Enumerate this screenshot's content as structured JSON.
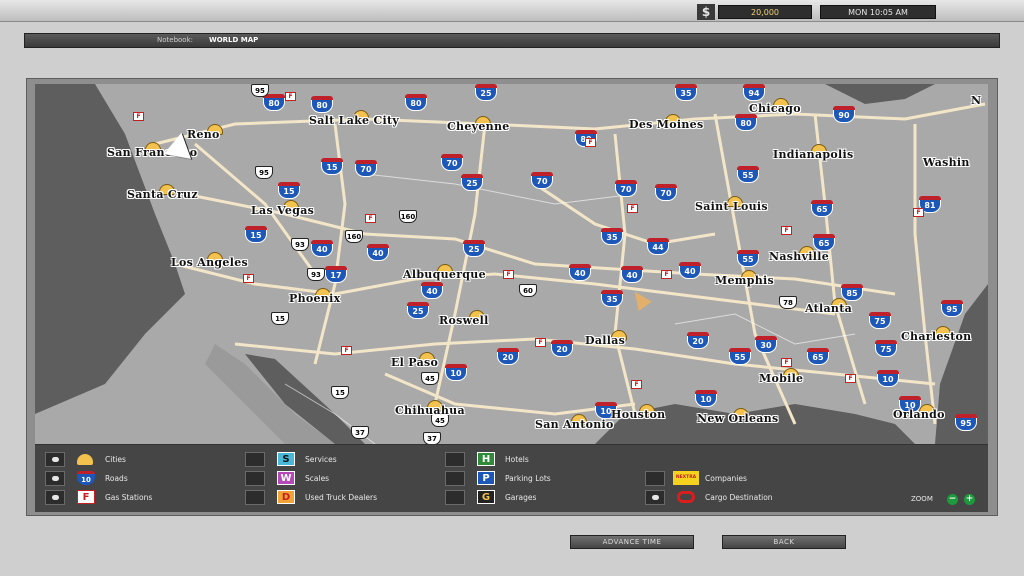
{
  "status": {
    "money_icon": "$",
    "money": "20,000",
    "time": "MON 10:05 AM"
  },
  "notebook": {
    "label": "Notebook:",
    "value": "WORLD MAP"
  },
  "map": {
    "cities": [
      {
        "name": "Salt Lake City"
      },
      {
        "name": "Cheyenne"
      },
      {
        "name": "Des Moines"
      },
      {
        "name": "Chicago"
      },
      {
        "name": "Reno"
      },
      {
        "name": "San Francisco"
      },
      {
        "name": "Santa Cruz"
      },
      {
        "name": "Las Vegas"
      },
      {
        "name": "Indianapolis"
      },
      {
        "name": "Washin"
      },
      {
        "name": "Saint Louis"
      },
      {
        "name": "Los Angeles"
      },
      {
        "name": "Albuquerque"
      },
      {
        "name": "Nashville"
      },
      {
        "name": "Memphis"
      },
      {
        "name": "Phoenix"
      },
      {
        "name": "Roswell"
      },
      {
        "name": "Atlanta"
      },
      {
        "name": "Charleston"
      },
      {
        "name": "Dallas"
      },
      {
        "name": "El Paso"
      },
      {
        "name": "Mobile"
      },
      {
        "name": "Chihuahua"
      },
      {
        "name": "Houston"
      },
      {
        "name": "New Orleans"
      },
      {
        "name": "San Antonio"
      },
      {
        "name": "Orlando"
      }
    ],
    "interstates": [
      "80",
      "80",
      "80",
      "80",
      "25",
      "35",
      "80",
      "70",
      "15",
      "70",
      "15",
      "25",
      "70",
      "15",
      "70",
      "55",
      "65",
      "70",
      "40",
      "25",
      "40",
      "44",
      "35",
      "55",
      "65",
      "40",
      "40",
      "40",
      "20",
      "20",
      "30",
      "10",
      "10",
      "10",
      "95",
      "75",
      "20",
      "35",
      "40",
      "25",
      "17",
      "10",
      "10",
      "55",
      "65",
      "75",
      "85",
      "81",
      "94",
      "90",
      "95"
    ],
    "us_routes": [
      "95",
      "95",
      "160",
      "160",
      "93",
      "93",
      "60",
      "78",
      "15",
      "15",
      "45",
      "45",
      "37",
      "37"
    ],
    "fuel_letter": "F",
    "north_label": "N"
  },
  "legend": {
    "items": [
      {
        "label": "Cities",
        "icon": "city-icon",
        "checked": true
      },
      {
        "label": "Roads",
        "icon": "road-shield-icon",
        "icon_text": "10",
        "checked": true
      },
      {
        "label": "Gas Stations",
        "icon": "gas-station-icon",
        "icon_text": "F",
        "checked": true
      },
      {
        "label": "Services",
        "icon": "services-icon",
        "icon_text": "S",
        "checked": false
      },
      {
        "label": "Scales",
        "icon": "scales-icon",
        "icon_text": "W",
        "checked": false
      },
      {
        "label": "Used Truck Dealers",
        "icon": "truck-dealer-icon",
        "icon_text": "D",
        "checked": false
      },
      {
        "label": "Hotels",
        "icon": "hotel-icon",
        "icon_text": "H",
        "checked": false
      },
      {
        "label": "Parking Lots",
        "icon": "parking-icon",
        "icon_text": "P",
        "checked": false
      },
      {
        "label": "Garages",
        "icon": "garage-icon",
        "icon_text": "G",
        "checked": false
      },
      {
        "label": "Companies",
        "icon": "company-icon",
        "icon_text": "NEXTRA",
        "checked": false
      },
      {
        "label": "Cargo Destination",
        "icon": "cargo-destination-icon",
        "checked": true
      }
    ],
    "zoom_label": "ZOOM",
    "zoom_out": "−",
    "zoom_in": "+"
  },
  "buttons": {
    "advance_time": "ADVANCE TIME",
    "back": "BACK"
  },
  "colors": {
    "interstate_blue": "#1d57b8",
    "interstate_red": "#c0202a",
    "road": "#f3e6c8",
    "land": "#a9a9a9",
    "ocean": "#5e5e5e",
    "city": "#f2c14e",
    "zoom": "#1d9a3c"
  }
}
